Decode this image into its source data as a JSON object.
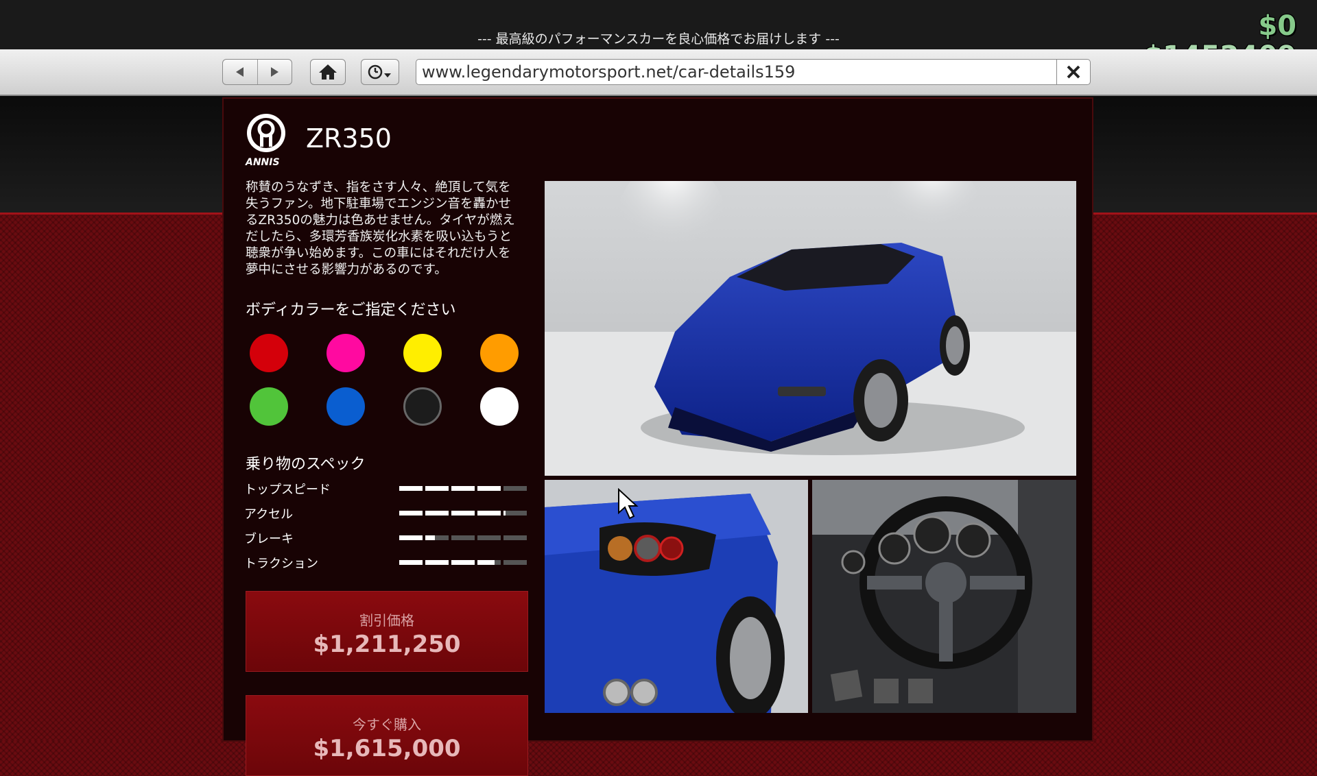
{
  "header": {
    "tagline": "--- 最高級のパフォーマンスカーを良心価格でお届けします ---",
    "cash": "$0",
    "bank": "$1452409"
  },
  "browser": {
    "url": "www.legendarymotorsport.net/car-details159"
  },
  "car": {
    "brand_logo": "annis-logo",
    "name": "ZR350",
    "description_lines": [
      "称賛のうなずき、指をさす人々、絶頂して気を",
      "失うファン。地下駐車場でエンジン音を轟かせ",
      "るZR350の魅力は色あせません。タイヤが燃え",
      "だしたら、多環芳香族炭化水素を吸い込もうと",
      "聴衆が争い始めます。この車にはそれだけ人を",
      "夢中にさせる影響力があるのです。"
    ]
  },
  "colors": {
    "heading": "ボディカラーをご指定ください",
    "swatches": [
      "#d4000a",
      "#ff0aa0",
      "#ffee00",
      "#ff9c00",
      "#51c43a",
      "#0a5ed0",
      "#1c1c1c",
      "#ffffff"
    ]
  },
  "specs": {
    "heading": "乗り物のスペック",
    "items": [
      {
        "label": "トップスピード",
        "value": 0.8
      },
      {
        "label": "アクセル",
        "value": 0.82
      },
      {
        "label": "ブレーキ",
        "value": 0.28
      },
      {
        "label": "トラクション",
        "value": 0.75
      }
    ]
  },
  "pricing": {
    "discount_label": "割引価格",
    "discount_price": "$1,211,250",
    "buy_label": "今すぐ購入",
    "buy_price": "$1,615,000"
  },
  "images": {
    "main": "car-front-three-quarter-view",
    "rear": "car-rear-tail-lights",
    "interior": "car-interior-steering-wheel"
  },
  "theme": {
    "accent": "#a31219",
    "panel_bg": "#180304"
  }
}
